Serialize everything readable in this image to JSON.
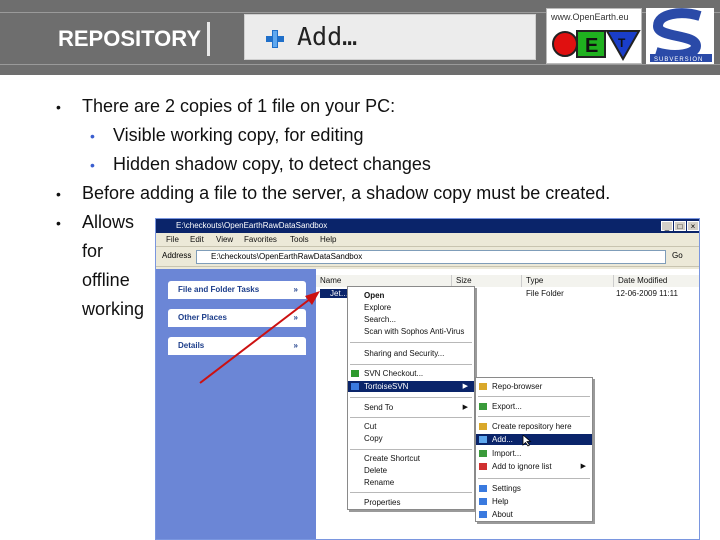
{
  "header": {
    "title": "REPOSITORY",
    "action_label": "Add…",
    "openearth_url": "www.OpenEarth.eu",
    "subversion_text": "SUBVERSION"
  },
  "bullets": [
    "There are 2 copies of 1 file on your PC:",
    "Visible working copy, for editing",
    "Hidden shadow copy, to detect changes",
    "Before adding a file to the server, a shadow copy must be created.",
    "Allows",
    "for",
    "offline",
    "working"
  ],
  "explorer": {
    "title": "E:\\checkouts\\OpenEarthRawDataSandbox",
    "menu": [
      "File",
      "Edit",
      "View",
      "Favorites",
      "Tools",
      "Help"
    ],
    "address_label": "Address",
    "address_value": "E:\\checkouts\\OpenEarthRawDataSandbox",
    "go_label": "Go",
    "tasks": [
      "File and Folder Tasks",
      "Other Places",
      "Details"
    ],
    "columns": [
      "Name",
      "Size",
      "Type",
      "Date Modified"
    ],
    "row": {
      "name": "Jet…",
      "size": "",
      "type": "File Folder",
      "date": "12-06-2009 11:11"
    }
  },
  "context_menu": [
    {
      "label": "Open"
    },
    {
      "label": "Explore"
    },
    {
      "label": "Search..."
    },
    {
      "label": "Scan with Sophos Anti-Virus"
    },
    {
      "label": "Sharing and Security..."
    },
    {
      "label": "SVN Checkout..."
    },
    {
      "label": "TortoiseSVN",
      "submenu": true
    },
    {
      "label": "Send To",
      "submenu": true
    },
    {
      "label": "Cut"
    },
    {
      "label": "Copy"
    },
    {
      "label": "Create Shortcut"
    },
    {
      "label": "Delete"
    },
    {
      "label": "Rename"
    },
    {
      "label": "Properties"
    }
  ],
  "submenu": [
    {
      "label": "Repo-browser"
    },
    {
      "label": "Export..."
    },
    {
      "label": "Create repository here"
    },
    {
      "label": "Add..."
    },
    {
      "label": "Import..."
    },
    {
      "label": "Add to ignore list"
    },
    {
      "label": "Settings"
    },
    {
      "label": "Help"
    },
    {
      "label": "About"
    }
  ],
  "colors": {
    "header_bg": "#6e6e6e",
    "arrow": "#cc1111",
    "highlight": "#0a246a"
  }
}
